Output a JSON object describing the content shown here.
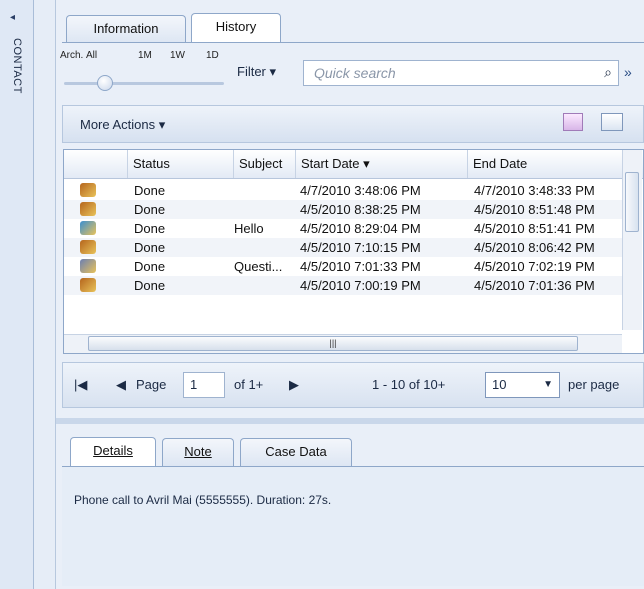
{
  "contact_strip": {
    "label": "CONTACT",
    "arrow": "◂"
  },
  "tabs": {
    "information": "Information",
    "history": "History"
  },
  "timeline": {
    "labels": [
      "Arch.",
      "All",
      "1M",
      "1W",
      "1D"
    ]
  },
  "filter": {
    "label": "Filter ▾",
    "search_placeholder": "Quick search"
  },
  "actions": {
    "more_actions": "More Actions ▾"
  },
  "grid": {
    "headers": [
      "Status",
      "Subject",
      "Start Date ▾",
      "End Date"
    ],
    "rows": [
      {
        "icon": "phone-call-icon",
        "status": "Done",
        "subject": "",
        "start": "4/7/2010 3:48:06 PM",
        "end": "4/7/2010 3:48:33 PM"
      },
      {
        "icon": "phone-call-icon",
        "status": "Done",
        "subject": "",
        "start": "4/5/2010 8:38:25 PM",
        "end": "4/5/2010 8:51:48 PM"
      },
      {
        "icon": "chat-icon",
        "status": "Done",
        "subject": "Hello",
        "start": "4/5/2010 8:29:04 PM",
        "end": "4/5/2010 8:51:41 PM"
      },
      {
        "icon": "phone-call-icon",
        "status": "Done",
        "subject": "",
        "start": "4/5/2010 7:10:15 PM",
        "end": "4/5/2010 8:06:42 PM"
      },
      {
        "icon": "email-icon",
        "status": "Done",
        "subject": "Questi...",
        "start": "4/5/2010 7:01:33 PM",
        "end": "4/5/2010 7:02:19 PM"
      },
      {
        "icon": "phone-call-icon",
        "status": "Done",
        "subject": "",
        "start": "4/5/2010 7:00:19 PM",
        "end": "4/5/2010 7:01:36 PM"
      }
    ]
  },
  "pager": {
    "page_label": "Page",
    "page_value": "1",
    "of_label": "of 1+",
    "range": "1 - 10 of 10+",
    "per_page_value": "10",
    "per_page_label": "per page"
  },
  "detail_tabs": {
    "details": "Details",
    "note": "Note",
    "case_data": "Case Data"
  },
  "details": {
    "text": "Phone call to Avril Mai (5555555). Duration: 27s."
  },
  "colors": {
    "accent": "#2b4e86",
    "panel": "#e9eff8",
    "border": "#8ea7c9"
  }
}
